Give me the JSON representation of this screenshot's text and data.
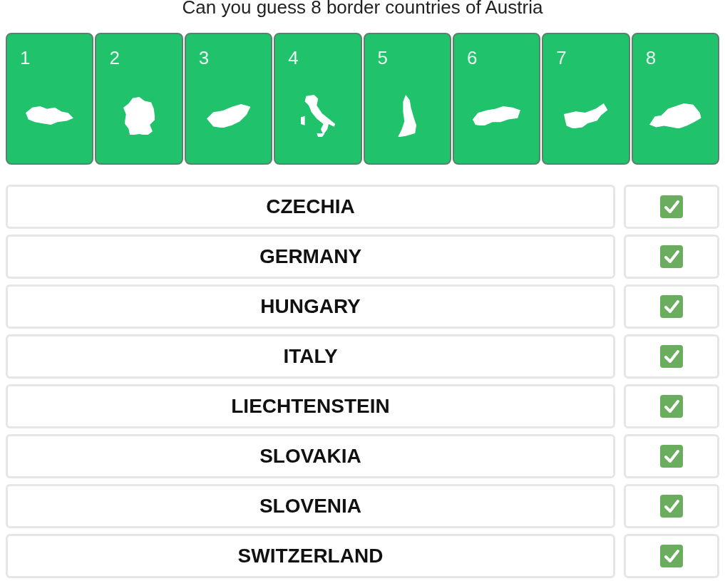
{
  "title": "Can you guess 8 border countries of Austria",
  "tiles": [
    {
      "number": "1"
    },
    {
      "number": "2"
    },
    {
      "number": "3"
    },
    {
      "number": "4"
    },
    {
      "number": "5"
    },
    {
      "number": "6"
    },
    {
      "number": "7"
    },
    {
      "number": "8"
    }
  ],
  "answers": [
    {
      "name": "CZECHIA",
      "checked": true
    },
    {
      "name": "GERMANY",
      "checked": true
    },
    {
      "name": "HUNGARY",
      "checked": true
    },
    {
      "name": "ITALY",
      "checked": true
    },
    {
      "name": "LIECHTENSTEIN",
      "checked": true
    },
    {
      "name": "SLOVAKIA",
      "checked": true
    },
    {
      "name": "SLOVENIA",
      "checked": true
    },
    {
      "name": "SWITZERLAND",
      "checked": true
    }
  ]
}
